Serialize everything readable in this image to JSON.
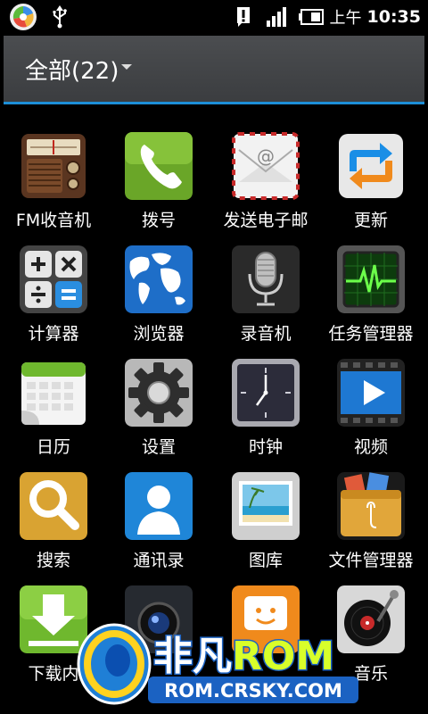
{
  "status_bar": {
    "ampm": "上午",
    "time": "10:35",
    "icons": [
      "launcher-icon",
      "usb-icon",
      "alert-icon",
      "signal-icon",
      "battery-icon"
    ]
  },
  "header": {
    "title": "全部(22)"
  },
  "apps": [
    {
      "label": "FM收音机",
      "icon": "radio-icon"
    },
    {
      "label": "拨号",
      "icon": "phone-icon"
    },
    {
      "label": "发送电子邮",
      "icon": "email-icon"
    },
    {
      "label": "更新",
      "icon": "update-icon"
    },
    {
      "label": "计算器",
      "icon": "calculator-icon"
    },
    {
      "label": "浏览器",
      "icon": "browser-globe-icon"
    },
    {
      "label": "录音机",
      "icon": "microphone-icon"
    },
    {
      "label": "任务管理器",
      "icon": "task-monitor-icon"
    },
    {
      "label": "日历",
      "icon": "calendar-icon"
    },
    {
      "label": "设置",
      "icon": "gear-icon"
    },
    {
      "label": "时钟",
      "icon": "clock-icon"
    },
    {
      "label": "视频",
      "icon": "video-play-icon"
    },
    {
      "label": "搜索",
      "icon": "search-icon"
    },
    {
      "label": "通讯录",
      "icon": "contact-icon"
    },
    {
      "label": "图库",
      "icon": "gallery-icon"
    },
    {
      "label": "文件管理器",
      "icon": "folder-icon"
    },
    {
      "label": "下载内",
      "icon": "download-icon"
    },
    {
      "label": "",
      "icon": "camera-icon"
    },
    {
      "label": "",
      "icon": "messaging-icon"
    },
    {
      "label": "音乐",
      "icon": "turntable-icon"
    }
  ],
  "watermark": {
    "brand": "非凡ROM",
    "url": "ROM.CRSKY.COM"
  }
}
